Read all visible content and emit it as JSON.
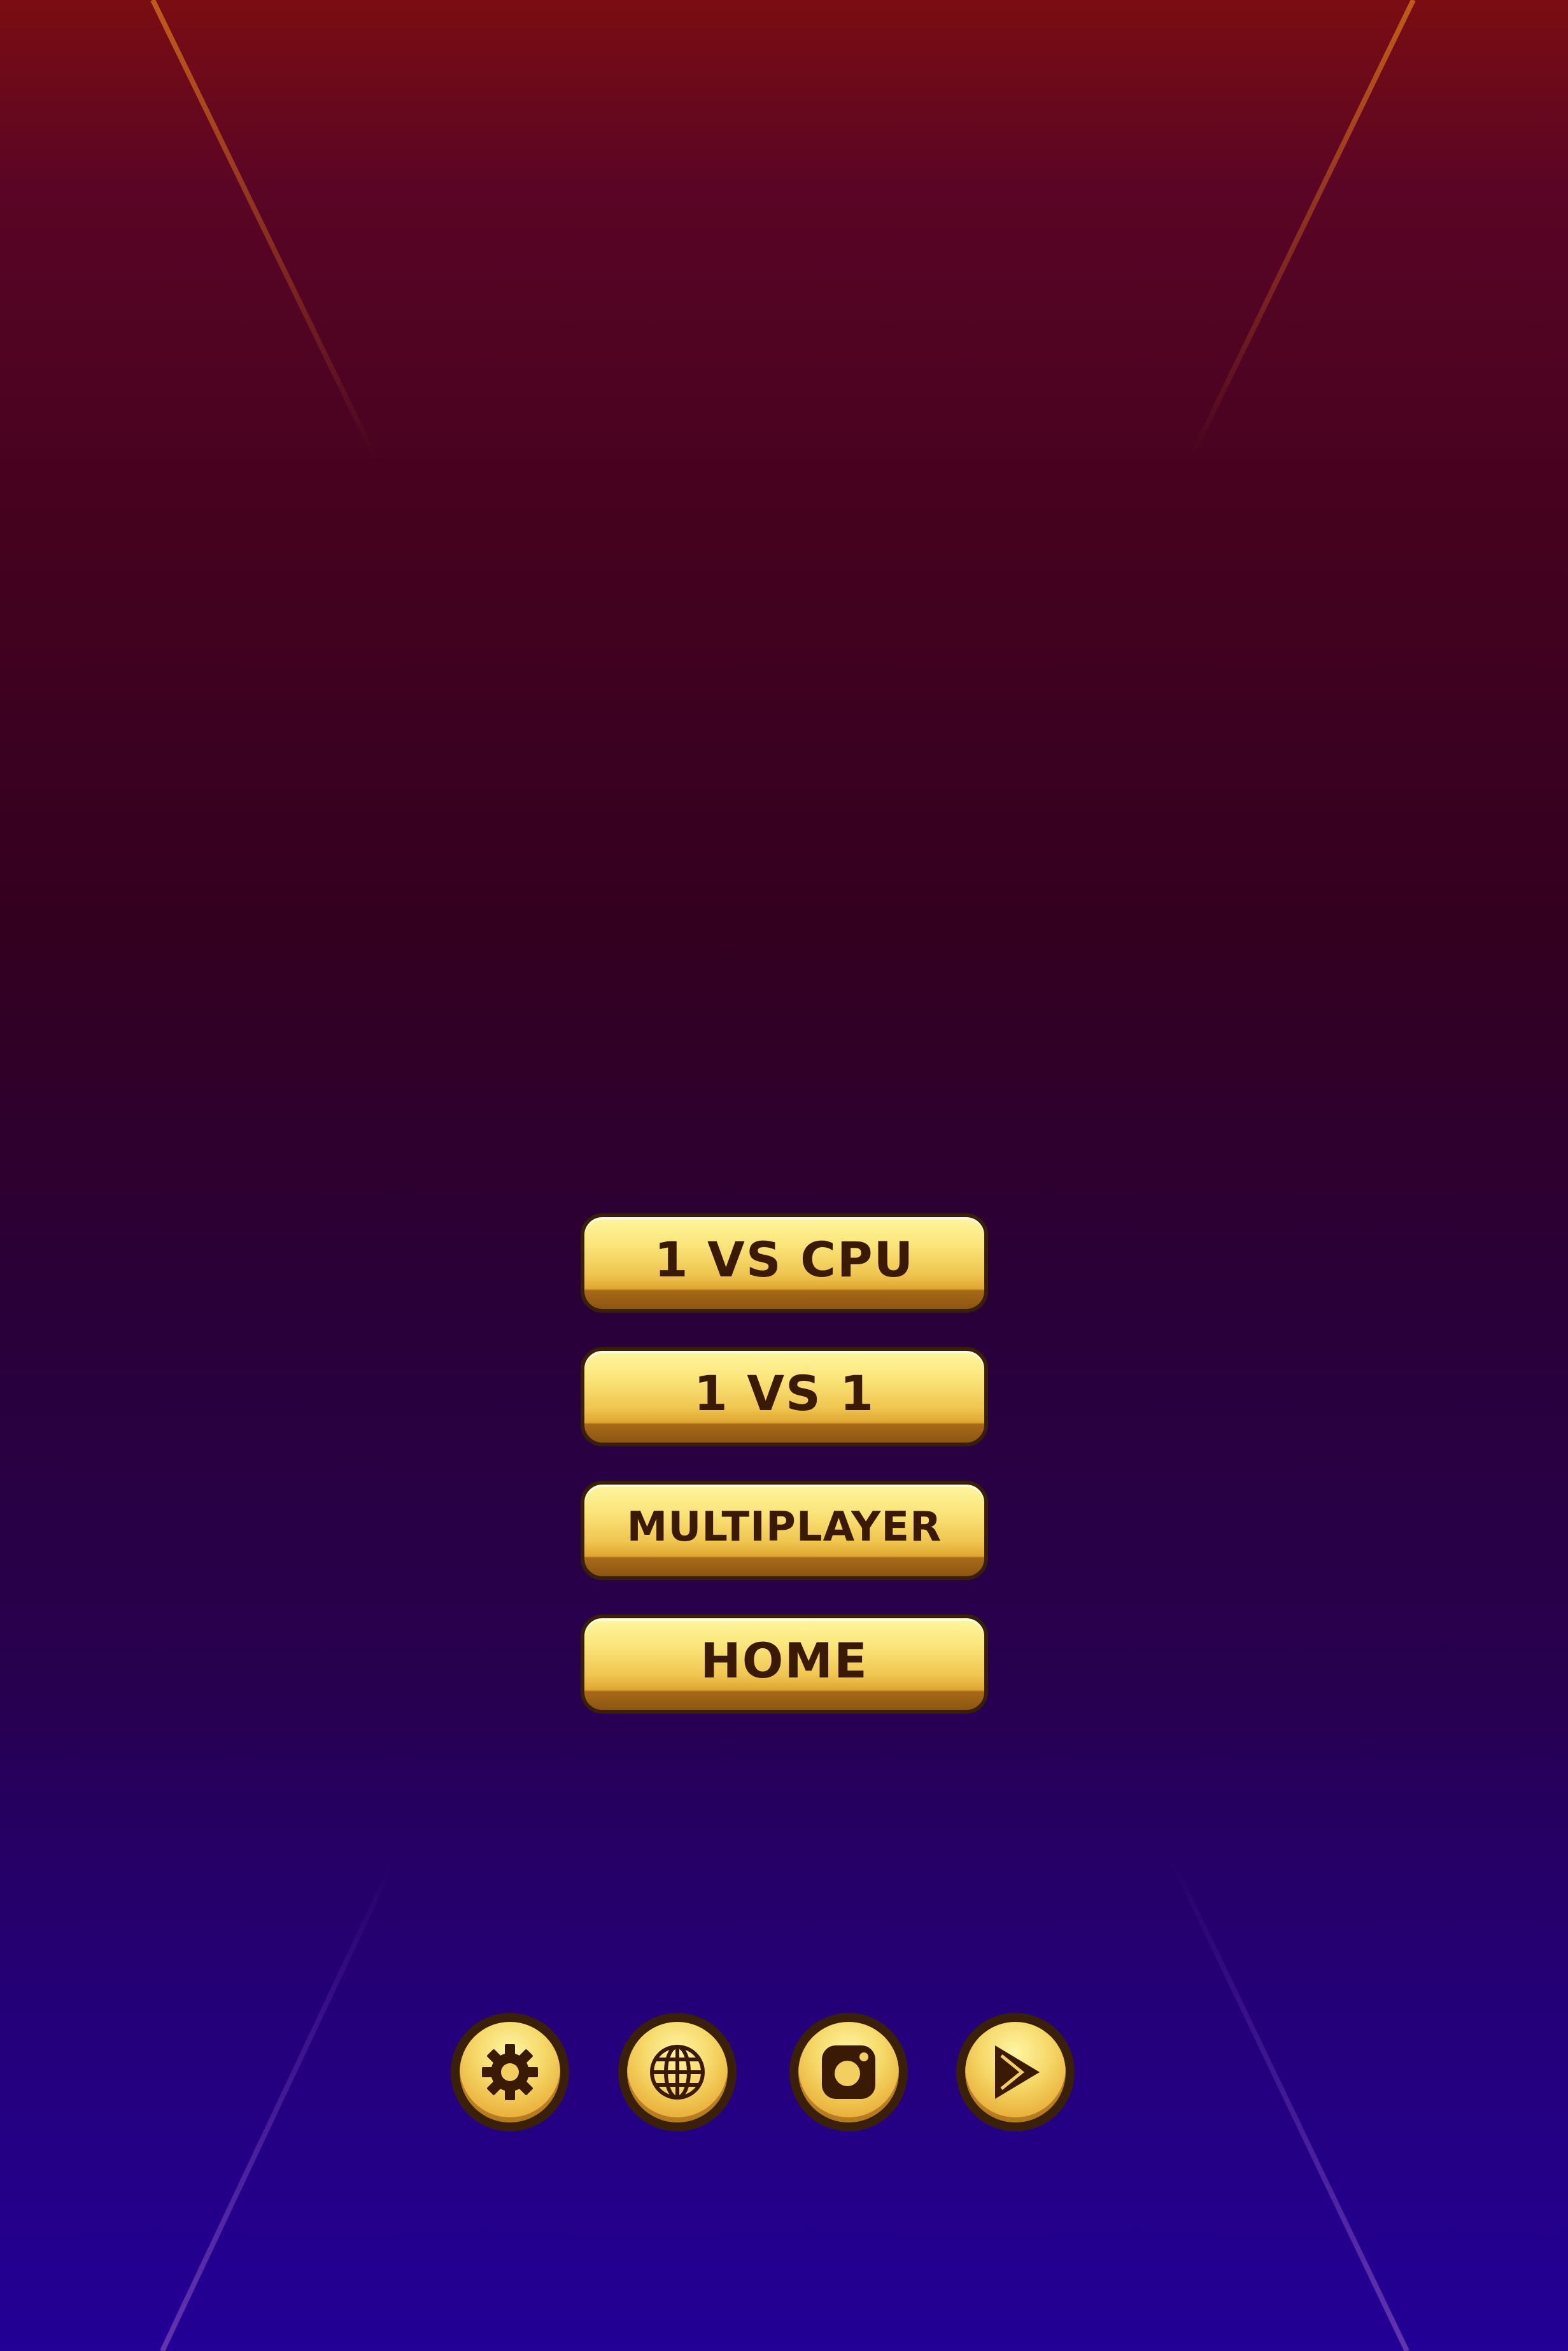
{
  "menu": {
    "buttons": [
      {
        "label": "1 VS CPU"
      },
      {
        "label": "1 VS 1"
      },
      {
        "label": "MULTIPLAYER"
      },
      {
        "label": "HOME"
      }
    ]
  },
  "footer": {
    "icons": [
      "gear-icon",
      "globe-icon",
      "instagram-icon",
      "play-store-icon"
    ]
  },
  "colors": {
    "button_gold": "#f6d868",
    "button_border": "#3a1f07",
    "label_dark": "#3b1a05",
    "bg_top": "#7a0d12",
    "bg_bottom": "#230096"
  }
}
